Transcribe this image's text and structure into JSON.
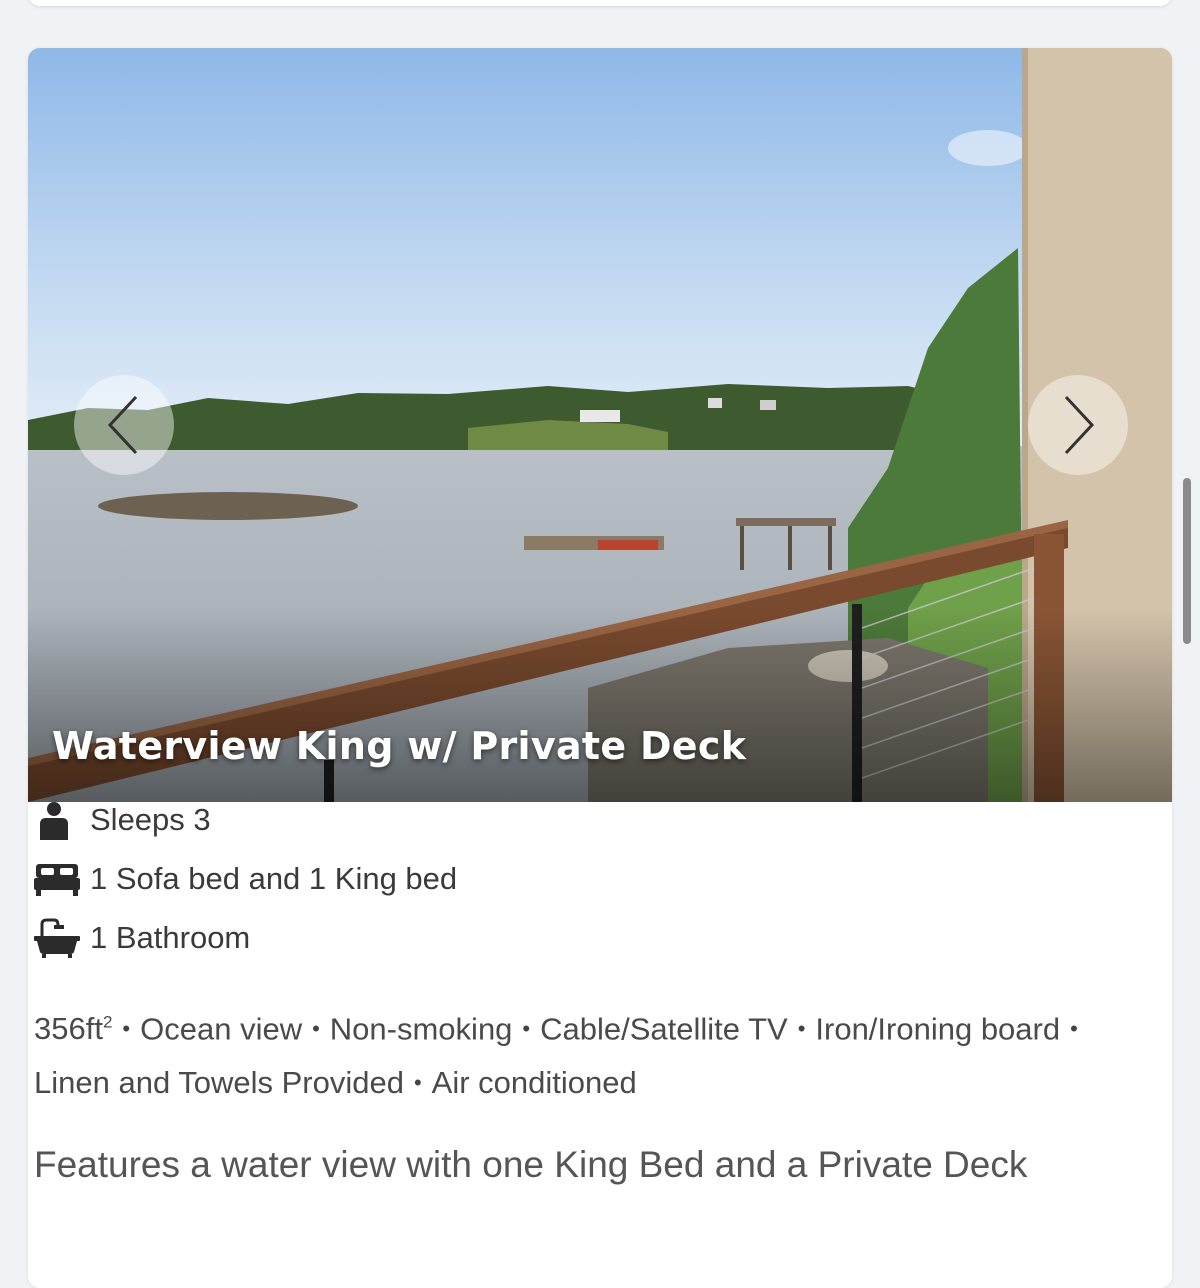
{
  "room": {
    "title": "Waterview King w/ Private Deck",
    "features": {
      "sleeps": "Sleeps 3",
      "beds": "1 Sofa bed and 1 King bed",
      "bathrooms": "1 Bathroom"
    },
    "amenities": {
      "size_value": "356ft",
      "size_unit_exp": "2",
      "items": [
        "Ocean view",
        "Non-smoking",
        "Cable/Satellite TV",
        "Iron/Ironing board",
        "Linen and Towels Provided",
        "Air conditioned"
      ]
    },
    "description": "Features a water view with one King Bed and a Private Deck"
  },
  "icons": {
    "prev": "chevron-left-icon",
    "next": "chevron-right-icon",
    "sleeps": "person-icon",
    "beds": "bed-icon",
    "bathrooms": "bathtub-icon"
  },
  "colors": {
    "page_bg": "#f0f2f5",
    "card_bg": "#ffffff",
    "text": "#3a3a3a",
    "icon": "#2b2b2b"
  }
}
